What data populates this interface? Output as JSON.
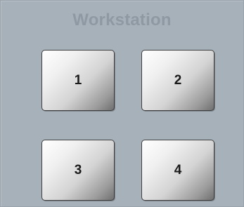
{
  "panel": {
    "title": "Workstation",
    "keys": [
      {
        "label": "1"
      },
      {
        "label": "2"
      },
      {
        "label": "3"
      },
      {
        "label": "4"
      }
    ]
  },
  "colors": {
    "panel_bg": "#a7b1ba",
    "title_text": "#8f99a3",
    "key_border": "#3f3f3f",
    "key_text": "#1b1b1b"
  }
}
